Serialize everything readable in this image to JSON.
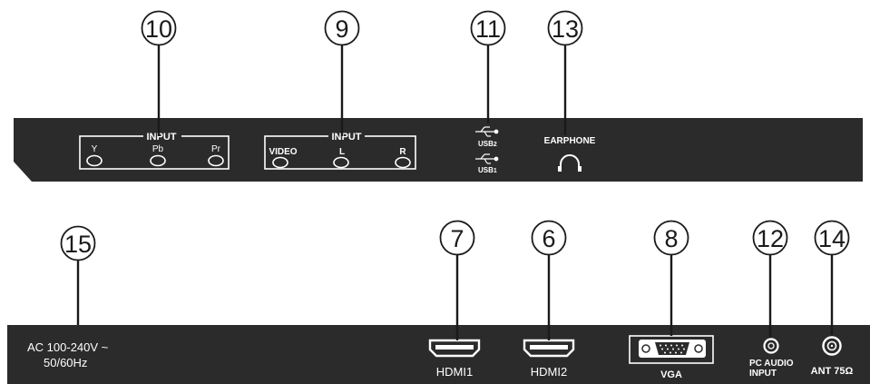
{
  "callouts": {
    "c10": "10",
    "c9": "9",
    "c11": "11",
    "c13": "13",
    "c15": "15",
    "c7": "7",
    "c6": "6",
    "c8": "8",
    "c12": "12",
    "c14": "14"
  },
  "top_panel": {
    "component_input": {
      "title": "INPUT",
      "jacks": [
        "Y",
        "Pb",
        "Pr"
      ]
    },
    "av_input": {
      "title": "INPUT",
      "jacks": [
        "VIDEO",
        "L",
        "R"
      ]
    },
    "usb": {
      "usb2_text": "USB",
      "usb2_sub": "2",
      "usb1_text": "USB",
      "usb1_sub": "1"
    },
    "earphone": "EARPHONE"
  },
  "bottom_panel": {
    "power_line1": "AC  100-240V ~",
    "power_line2": "50/60Hz",
    "hdmi1": "HDMI1",
    "hdmi2": "HDMI2",
    "vga": "VGA",
    "pc_audio_line1": "PC AUDIO",
    "pc_audio_line2": "INPUT",
    "antenna": "ANT 75Ω"
  },
  "colors": {
    "panel": "#2b2b2b",
    "ink": "#1a1a1a",
    "label": "#ffffff"
  }
}
